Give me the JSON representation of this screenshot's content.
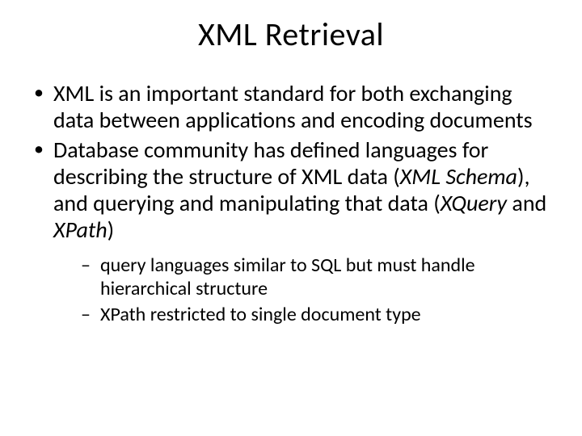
{
  "title": "XML Retrieval",
  "bullets": [
    {
      "text": "XML is an important standard for both exchanging data between applications and encoding documents"
    },
    {
      "runs": [
        {
          "t": "Database community has defined languages for describing the structure of XML data ("
        },
        {
          "t": "XML Schema",
          "i": true
        },
        {
          "t": "), and querying and manipulating that data ("
        },
        {
          "t": "XQuery",
          "i": true
        },
        {
          "t": " and "
        },
        {
          "t": "XPath",
          "i": true
        },
        {
          "t": ")"
        }
      ],
      "sub": [
        {
          "text": "query languages similar to SQL but must handle hierarchical structure"
        },
        {
          "text": "XPath restricted to single document type"
        }
      ]
    }
  ]
}
